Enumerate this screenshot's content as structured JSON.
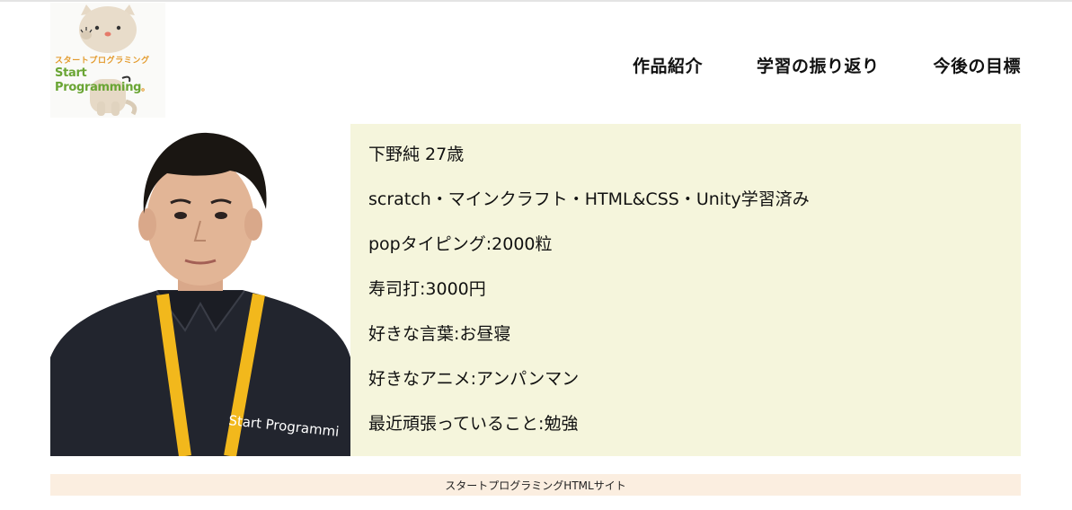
{
  "logo": {
    "kana": "スタートプログラミング",
    "name": "Start Programming",
    "mark": "。"
  },
  "nav": {
    "items": [
      {
        "label": "作品紹介"
      },
      {
        "label": "学習の振り返り"
      },
      {
        "label": "今後の目標"
      }
    ]
  },
  "photo": {
    "shirt_text": "Start Programmi"
  },
  "profile": {
    "lines": [
      "下野純 27歳",
      "scratch・マインクラフト・HTML&CSS・Unity学習済み",
      "popタイピング:2000粒",
      "寿司打:3000円",
      "好きな言葉:お昼寝",
      "好きなアニメ:アンパンマン",
      "最近頑張っていること:勉強"
    ]
  },
  "footer": {
    "text": "スタートプログラミングHTMLサイト"
  },
  "colors": {
    "profile_bg": "#f5f5dc",
    "footer_bg": "#fbeee0",
    "logo_green": "#6aa534",
    "logo_orange": "#e39a2b",
    "lanyard": "#f2b81c",
    "shirt": "#22252e"
  }
}
